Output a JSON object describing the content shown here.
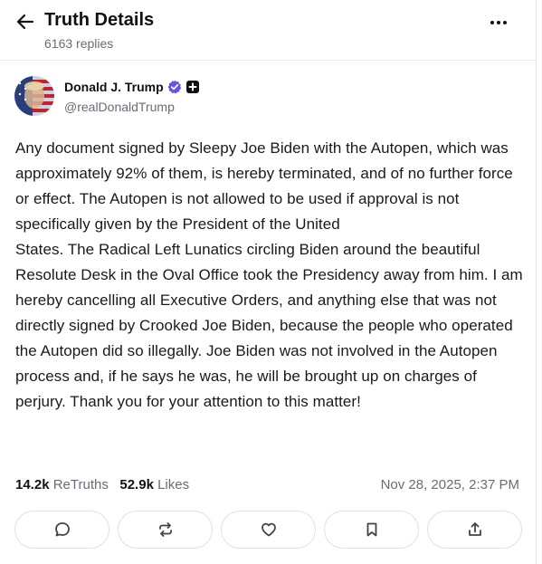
{
  "header": {
    "title": "Truth Details",
    "replies": "6163 replies"
  },
  "author": {
    "name": "Donald J. Trump",
    "handle": "@realDonaldTrump"
  },
  "post": {
    "text": "Any document signed by Sleepy Joe Biden with the Autopen, which was approximately 92% of them, is hereby terminated, and of no further force or effect. The Autopen is not allowed to be used if approval is not specifically given by the President of the United\nStates. The Radical Left Lunatics circling Biden around the beautiful Resolute Desk in the Oval Office took the Presidency away from him. I am hereby cancelling all Executive Orders, and anything else that was not directly signed by Crooked Joe Biden, because the people who operated the Autopen did so illegally. Joe Biden was not involved in the Autopen process and, if he says he was, he will be brought up on charges of perjury. Thank you for your attention to this matter!",
    "retruths_count": "14.2k",
    "retruths_label": "ReTruths",
    "likes_count": "52.9k",
    "likes_label": "Likes",
    "timestamp": "Nov 28, 2025, 2:37 PM"
  },
  "icons": {
    "back": "arrow-left-icon",
    "more": "more-horizontal-icon",
    "verified": "verified-badge-icon",
    "plus": "plus-badge-icon",
    "reply": "reply-bubble-icon",
    "retruth": "repost-icon",
    "like": "heart-icon",
    "bookmark": "bookmark-icon",
    "share": "share-icon"
  },
  "colors": {
    "accent": "#6b52e6",
    "muted_text": "#6b6b78",
    "border": "#e1e1e6"
  }
}
